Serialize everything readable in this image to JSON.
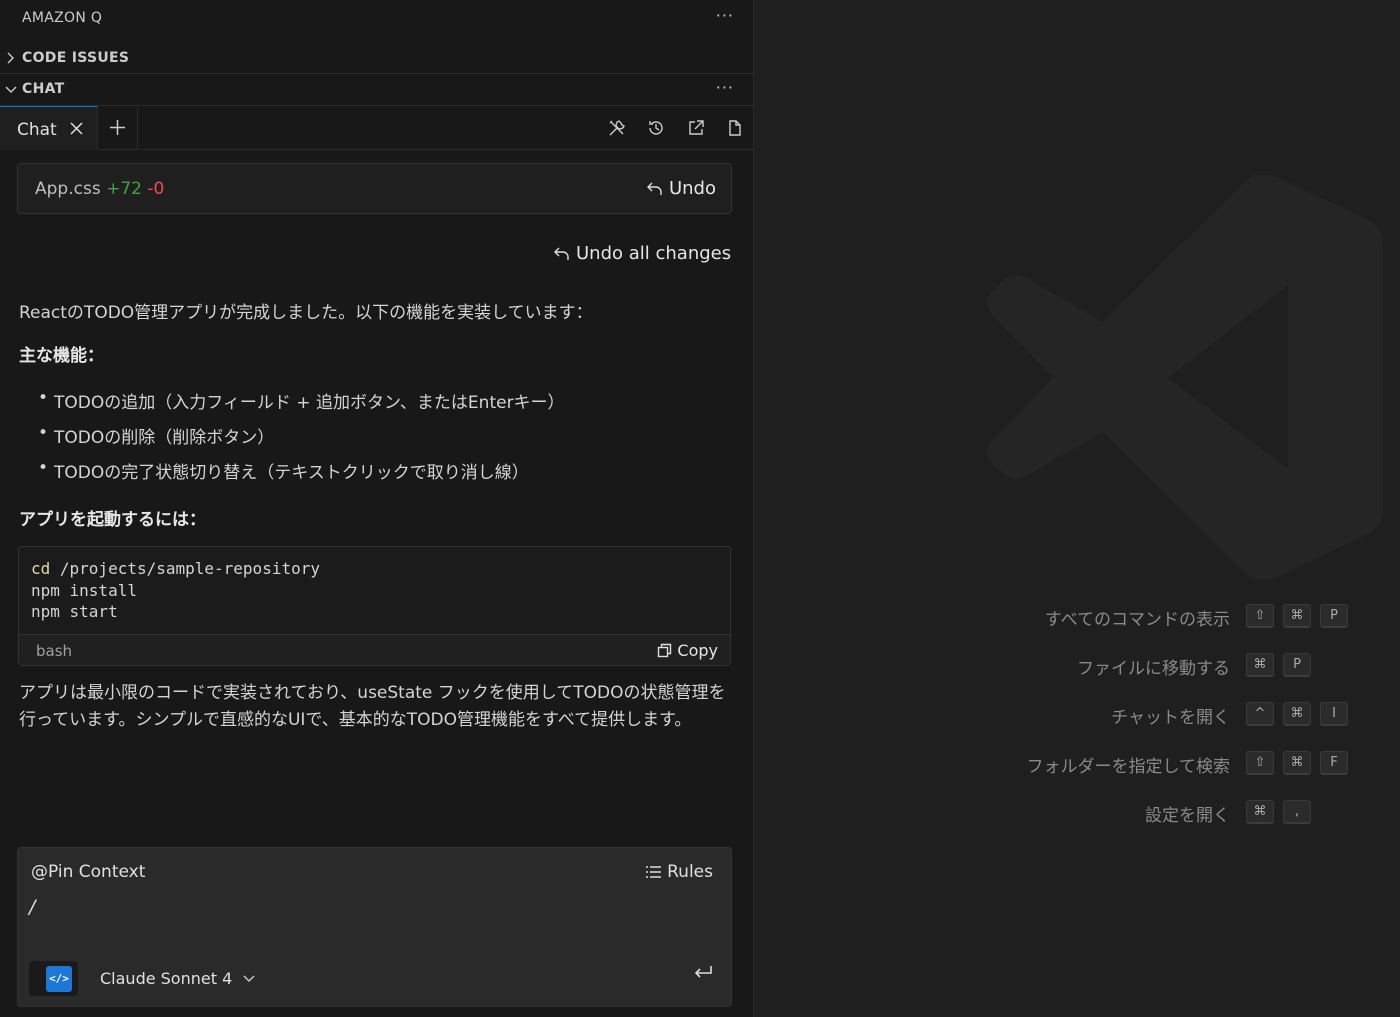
{
  "panel": {
    "title": "AMAZON Q",
    "sections": {
      "code_issues": "CODE ISSUES",
      "chat": "CHAT"
    }
  },
  "tabs": {
    "active_label": "Chat"
  },
  "file_change": {
    "filename": "App.css",
    "added": "+72",
    "removed": "-0",
    "undo_label": "Undo"
  },
  "undo_all_label": "Undo all changes",
  "message": {
    "intro": "ReactのTODO管理アプリが完成しました。以下の機能を実装しています：",
    "features_heading": "主な機能：",
    "features": [
      "TODOの追加（入力フィールド + 追加ボタン、またはEnterキー）",
      "TODOの削除（削除ボタン）",
      "TODOの完了状態切り替え（テキストクリックで取り消し線）"
    ],
    "launch_heading": "アプリを起動するには：",
    "code": {
      "lines": [
        {
          "cmd": "cd",
          "rest": " /projects/sample-repository"
        },
        {
          "cmd": "",
          "rest": "npm install"
        },
        {
          "cmd": "",
          "rest": "npm start"
        }
      ],
      "language": "bash",
      "copy_label": "Copy"
    },
    "summary": "アプリは最小限のコードで実装されており、useState フックを使用してTODOの状態管理を行っています。シンプルで直感的なUIで、基本的なTODO管理機能をすべて提供します。"
  },
  "input": {
    "pin_context": "@Pin Context",
    "rules_label": "Rules",
    "prompt_value": "/",
    "model_name": "Claude Sonnet 4",
    "model_icon_text": "</>"
  },
  "shortcuts": [
    {
      "label": "すべてのコマンドの表示",
      "keys": [
        "⇧",
        "⌘",
        "P"
      ]
    },
    {
      "label": "ファイルに移動する",
      "keys": [
        "⌘",
        "P"
      ]
    },
    {
      "label": "チャットを開く",
      "keys": [
        "^",
        "⌘",
        "I"
      ]
    },
    {
      "label": "フォルダーを指定して検索",
      "keys": [
        "⇧",
        "⌘",
        "F"
      ]
    },
    {
      "label": "設定を開く",
      "keys": [
        "⌘",
        ","
      ]
    }
  ],
  "colors": {
    "accent": "#0078d4",
    "added": "#3fa33f",
    "removed": "#f14c4c",
    "model_icon_bg": "#1c77d6"
  }
}
